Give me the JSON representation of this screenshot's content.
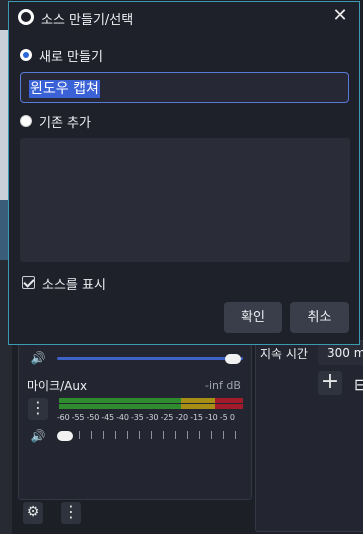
{
  "dialog": {
    "title": "소스 만들기/선택",
    "close_glyph": "✕",
    "create_new_label": "새로 만들기",
    "source_name": "윈도우 캡쳐",
    "add_existing_label": "기존 추가",
    "existing_sources": [],
    "show_source_label": "소스를 표시",
    "show_source_checked": true,
    "ok_label": "확인",
    "cancel_label": "취소"
  },
  "mixer": {
    "channel_name": "마이크/Aux",
    "channel_level": "-inf dB",
    "ticks": "-60 -55 -50 -45 -40 -35 -30 -25 -20 -15 -10 -5  0",
    "first_channel_volume": 0.96,
    "mic_volume": 0.0,
    "speaker_glyph": "🔊",
    "menu_glyph": "⋮",
    "gear_glyph": "⚙"
  },
  "controls": {
    "duration_label": "지속 시간",
    "duration_value": "300 m",
    "add_glyph": "+",
    "remove_glyph": "⊟"
  },
  "colors": {
    "accent_border": "#3b9bb0",
    "selection": "#3a62d6",
    "meter_green": "#2e8b2e",
    "meter_yellow": "#a78f16",
    "meter_red": "#a11b2b"
  }
}
